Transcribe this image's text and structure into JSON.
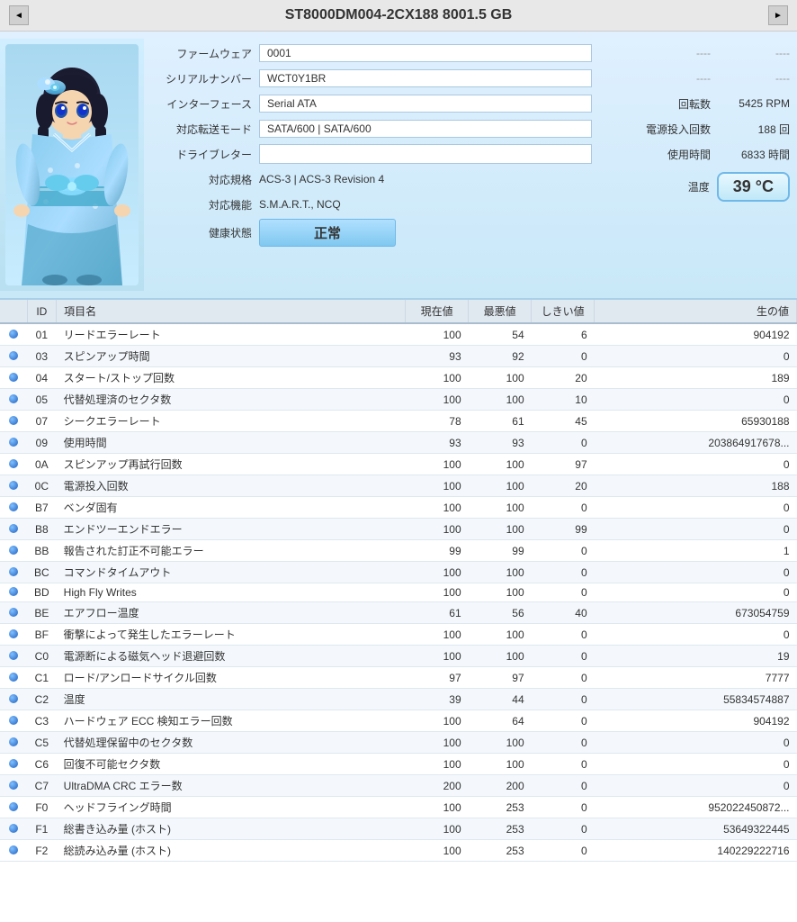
{
  "titleBar": {
    "title": "ST8000DM004-2CX188 8001.5 GB",
    "prevBtn": "◄",
    "nextBtn": "►"
  },
  "infoFields": {
    "firmware_label": "ファームウェア",
    "firmware_value": "0001",
    "serial_label": "シリアルナンバー",
    "serial_value": "WCT0Y1BR",
    "interface_label": "インターフェース",
    "interface_value": "Serial ATA",
    "transfer_label": "対応転送モード",
    "transfer_value": "SATA/600 | SATA/600",
    "drive_label": "ドライブレター",
    "drive_value": "",
    "spec_label": "対応規格",
    "spec_value": "ACS-3 | ACS-3 Revision 4",
    "feature_label": "対応機能",
    "feature_value": "S.M.A.R.T., NCQ",
    "health_label": "健康状態",
    "health_value": "正常"
  },
  "rightFields": {
    "rotation_label": "回転数",
    "rotation_value": "5425 RPM",
    "power_label": "電源投入回数",
    "power_value": "188 回",
    "usage_label": "使用時間",
    "usage_value": "6833 時間",
    "dash1": "----",
    "dash2": "----",
    "temp_label": "温度",
    "temp_value": "39 °C"
  },
  "tableHeaders": [
    "",
    "ID",
    "項目名",
    "現在値",
    "最悪値",
    "しきい値",
    "生の値"
  ],
  "tableRows": [
    {
      "id": "01",
      "name": "リードエラーレート",
      "current": "100",
      "worst": "54",
      "threshold": "6",
      "raw": "904192"
    },
    {
      "id": "03",
      "name": "スピンアップ時間",
      "current": "93",
      "worst": "92",
      "threshold": "0",
      "raw": "0"
    },
    {
      "id": "04",
      "name": "スタート/ストップ回数",
      "current": "100",
      "worst": "100",
      "threshold": "20",
      "raw": "189"
    },
    {
      "id": "05",
      "name": "代替処理済のセクタ数",
      "current": "100",
      "worst": "100",
      "threshold": "10",
      "raw": "0"
    },
    {
      "id": "07",
      "name": "シークエラーレート",
      "current": "78",
      "worst": "61",
      "threshold": "45",
      "raw": "65930188"
    },
    {
      "id": "09",
      "name": "使用時間",
      "current": "93",
      "worst": "93",
      "threshold": "0",
      "raw": "203864917678..."
    },
    {
      "id": "0A",
      "name": "スピンアップ再試行回数",
      "current": "100",
      "worst": "100",
      "threshold": "97",
      "raw": "0"
    },
    {
      "id": "0C",
      "name": "電源投入回数",
      "current": "100",
      "worst": "100",
      "threshold": "20",
      "raw": "188"
    },
    {
      "id": "B7",
      "name": "ベンダ固有",
      "current": "100",
      "worst": "100",
      "threshold": "0",
      "raw": "0"
    },
    {
      "id": "B8",
      "name": "エンドツーエンドエラー",
      "current": "100",
      "worst": "100",
      "threshold": "99",
      "raw": "0"
    },
    {
      "id": "BB",
      "name": "報告された訂正不可能エラー",
      "current": "99",
      "worst": "99",
      "threshold": "0",
      "raw": "1"
    },
    {
      "id": "BC",
      "name": "コマンドタイムアウト",
      "current": "100",
      "worst": "100",
      "threshold": "0",
      "raw": "0"
    },
    {
      "id": "BD",
      "name": "High Fly Writes",
      "current": "100",
      "worst": "100",
      "threshold": "0",
      "raw": "0"
    },
    {
      "id": "BE",
      "name": "エアフロー温度",
      "current": "61",
      "worst": "56",
      "threshold": "40",
      "raw": "673054759"
    },
    {
      "id": "BF",
      "name": "衝撃によって発生したエラーレート",
      "current": "100",
      "worst": "100",
      "threshold": "0",
      "raw": "0"
    },
    {
      "id": "C0",
      "name": "電源断による磁気ヘッド退避回数",
      "current": "100",
      "worst": "100",
      "threshold": "0",
      "raw": "19"
    },
    {
      "id": "C1",
      "name": "ロード/アンロードサイクル回数",
      "current": "97",
      "worst": "97",
      "threshold": "0",
      "raw": "7777"
    },
    {
      "id": "C2",
      "name": "温度",
      "current": "39",
      "worst": "44",
      "threshold": "0",
      "raw": "55834574887"
    },
    {
      "id": "C3",
      "name": "ハードウェア ECC 検知エラー回数",
      "current": "100",
      "worst": "64",
      "threshold": "0",
      "raw": "904192"
    },
    {
      "id": "C5",
      "name": "代替処理保留中のセクタ数",
      "current": "100",
      "worst": "100",
      "threshold": "0",
      "raw": "0"
    },
    {
      "id": "C6",
      "name": "回復不可能セクタ数",
      "current": "100",
      "worst": "100",
      "threshold": "0",
      "raw": "0"
    },
    {
      "id": "C7",
      "name": "UltraDMA CRC エラー数",
      "current": "200",
      "worst": "200",
      "threshold": "0",
      "raw": "0"
    },
    {
      "id": "F0",
      "name": "ヘッドフライング時間",
      "current": "100",
      "worst": "253",
      "threshold": "0",
      "raw": "952022450872..."
    },
    {
      "id": "F1",
      "name": "総書き込み量 (ホスト)",
      "current": "100",
      "worst": "253",
      "threshold": "0",
      "raw": "53649322445"
    },
    {
      "id": "F2",
      "name": "総読み込み量 (ホスト)",
      "current": "100",
      "worst": "253",
      "threshold": "0",
      "raw": "140229222716"
    }
  ]
}
